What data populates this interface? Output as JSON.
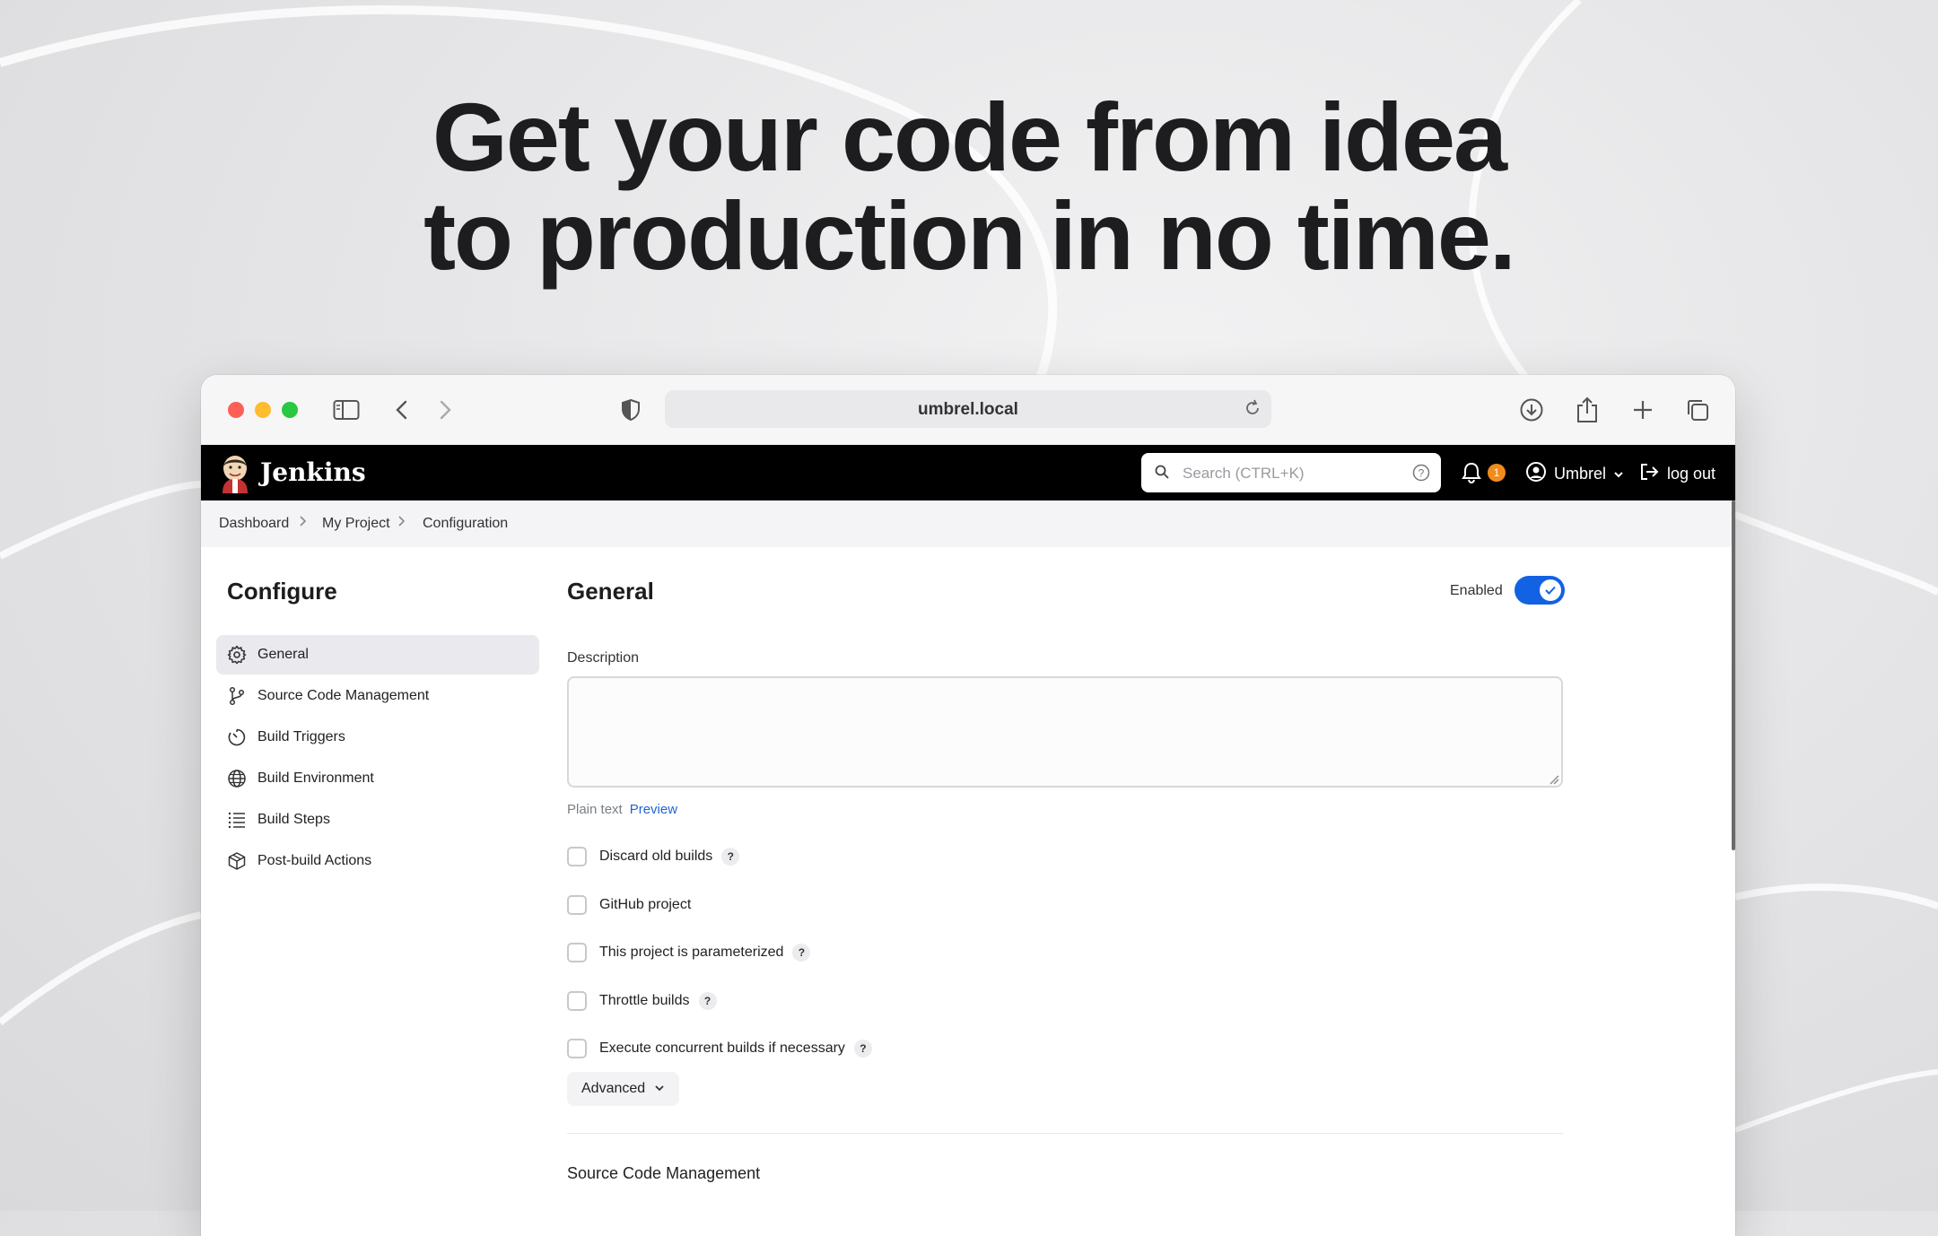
{
  "headline": {
    "line1": "Get your code from idea",
    "line2": "to production in no time."
  },
  "browser": {
    "url": "umbrel.local"
  },
  "jenkins": {
    "title": "Jenkins",
    "search_placeholder": "Search (CTRL+K)",
    "notification_count": "1",
    "user_name": "Umbrel",
    "logout_label": "log out"
  },
  "breadcrumb": {
    "items": [
      "Dashboard",
      "My Project",
      "Configuration"
    ]
  },
  "sidebar": {
    "title": "Configure",
    "items": [
      {
        "label": "General",
        "icon": "gear-icon"
      },
      {
        "label": "Source Code Management",
        "icon": "branch-icon"
      },
      {
        "label": "Build Triggers",
        "icon": "timer-icon"
      },
      {
        "label": "Build Environment",
        "icon": "globe-icon"
      },
      {
        "label": "Build Steps",
        "icon": "list-icon"
      },
      {
        "label": "Post-build Actions",
        "icon": "package-icon"
      }
    ]
  },
  "main": {
    "section_title": "General",
    "enabled_label": "Enabled",
    "enabled": true,
    "description_label": "Description",
    "description_value": "",
    "format_plain": "Plain text",
    "format_preview": "Preview",
    "options": [
      {
        "label": "Discard old builds",
        "help": "?",
        "checked": false
      },
      {
        "label": "GitHub project",
        "help": "",
        "checked": false
      },
      {
        "label": "This project is parameterized",
        "help": "?",
        "checked": false
      },
      {
        "label": "Throttle builds",
        "help": "?",
        "checked": false
      },
      {
        "label": "Execute concurrent builds if necessary",
        "help": "?",
        "checked": false
      }
    ],
    "advanced_label": "Advanced",
    "next_section_title": "Source Code Management"
  },
  "colors": {
    "accent": "#1262e3",
    "badge": "#f08c1e",
    "header_bg": "#000000"
  }
}
